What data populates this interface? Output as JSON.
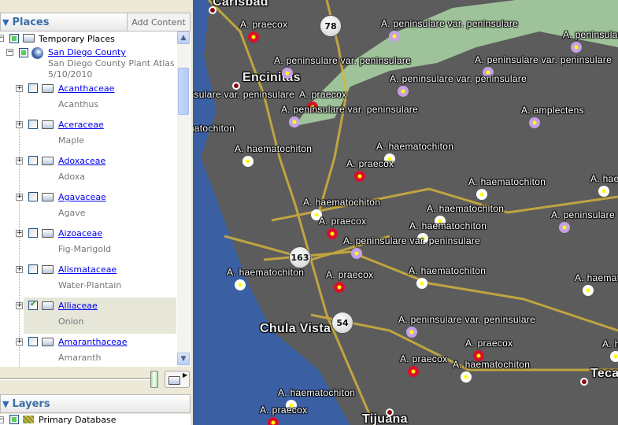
{
  "places": {
    "title": "Places",
    "add_content": "Add Content",
    "root": "Temporary Places",
    "county": {
      "name": "San Diego County",
      "desc": "San Diego County Plant Atlas",
      "date": "5/10/2010"
    },
    "families": [
      {
        "name": "Acanthaceae",
        "common": "Acanthus",
        "checked": false
      },
      {
        "name": "Aceraceae",
        "common": "Maple",
        "checked": false
      },
      {
        "name": "Adoxaceae",
        "common": "Adoxa",
        "checked": false
      },
      {
        "name": "Agavaceae",
        "common": "Agave",
        "checked": false
      },
      {
        "name": "Aizoaceae",
        "common": "Fig-Marigold",
        "checked": false
      },
      {
        "name": "Alismataceae",
        "common": "Water-Plantain",
        "checked": false
      },
      {
        "name": "Alliaceae",
        "common": "Onion",
        "checked": true
      },
      {
        "name": "Amaranthaceae",
        "common": "Amaranth",
        "checked": false
      }
    ]
  },
  "layers": {
    "title": "Layers",
    "items": [
      "Primary Database"
    ]
  },
  "map": {
    "cities": [
      "Carlsbad",
      "Encinitas",
      "Chula Vista",
      "Tijuana",
      "Tecate"
    ],
    "highways": [
      "78",
      "163",
      "54"
    ],
    "labels": [
      "A. praecox",
      "A. peninsulare var. peninsulare",
      "A. peninsulare var. peninsulare",
      "A. peninsulare var. peninsulare",
      "A. peninsulare var. peninsulare",
      "A. peninsulare var. peninsulare",
      "A. peninsulare var. peninsulare",
      "A. praecox",
      "A. peninsulare var. peninsulare",
      "A. amplectens",
      "A. haematochiton",
      "A. haematochiton",
      "A. haematochiton",
      "A. praecox",
      "A. haematochiton",
      "A. haematochiton",
      "A. praecox",
      "A. haematochiton",
      "A. haematochiton",
      "A. peninsulare var. peninsulare",
      "A. peninsulare",
      "A. haematochiton",
      "A. praecox",
      "A. haematochiton",
      "A. haematochiton",
      "A. peninsulare var. peninsulare",
      "A. praecox",
      "A. praecox",
      "A. haematochiton",
      "A. haematochiton",
      "A. praecox",
      "A. haematochiton",
      "A. haematochiton"
    ]
  }
}
